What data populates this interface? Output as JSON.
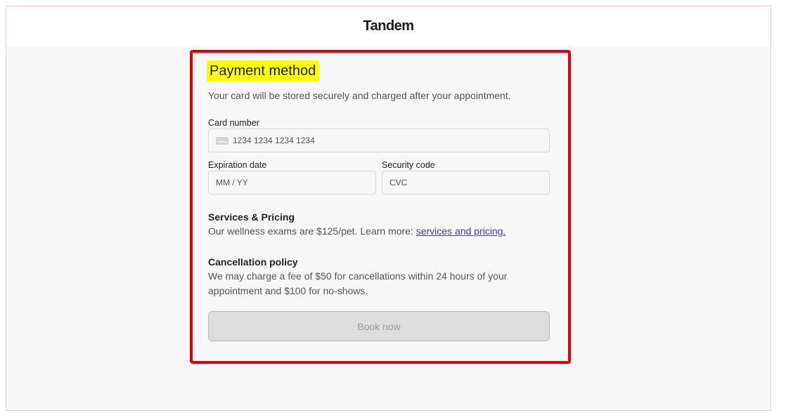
{
  "header": {
    "brand": "Tandem"
  },
  "payment": {
    "title": "Payment method",
    "subtitle": "Your card will be stored securely and charged after your appointment.",
    "card_number": {
      "label": "Card number",
      "placeholder": "1234 1234 1234 1234",
      "icon": "credit-card-icon"
    },
    "expiration": {
      "label": "Expiration date",
      "placeholder": "MM / YY"
    },
    "security": {
      "label": "Security code",
      "placeholder": "CVC"
    }
  },
  "services": {
    "title": "Services & Pricing",
    "text": "Our wellness exams are $125/pet. Learn more: ",
    "link": "services and pricing."
  },
  "cancellation": {
    "title": "Cancellation policy",
    "text": "We may charge a fee of $50 for cancellations within 24 hours of your appointment and $100 for no-shows."
  },
  "actions": {
    "book_label": "Book now"
  },
  "colors": {
    "highlight": "#ffff00",
    "outline": "#e0000a",
    "link": "#3b3bd6"
  }
}
